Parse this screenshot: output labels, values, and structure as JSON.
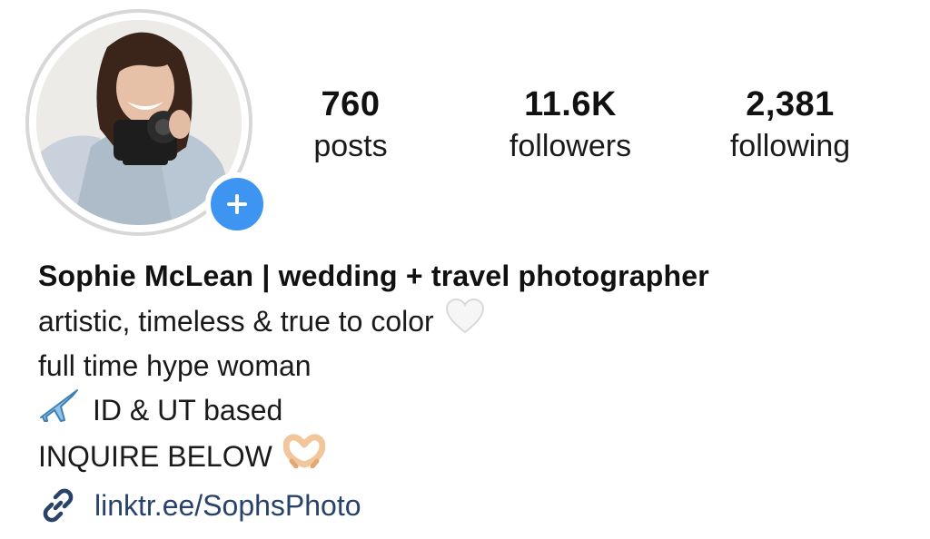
{
  "profile": {
    "add_story_symbol": "+",
    "stats": {
      "posts": {
        "value": "760",
        "label": "posts"
      },
      "followers": {
        "value": "11.6K",
        "label": "followers"
      },
      "following": {
        "value": "2,381",
        "label": "following"
      }
    },
    "bio": {
      "name": "Sophie McLean | wedding + travel photographer",
      "line1": "artistic, timeless & true to color",
      "line2": "full time hype woman",
      "line3": "ID & UT based",
      "line4": "INQUIRE BELOW"
    },
    "link": {
      "text": "linktr.ee/SophsPhoto"
    }
  },
  "colors": {
    "accent_blue": "#3d95f1",
    "link_text": "#28426a",
    "ring": "#d7d7d7"
  },
  "icons": [
    "plus-icon",
    "white-heart-emoji",
    "airplane-emoji",
    "heart-hands-emoji",
    "link-icon"
  ]
}
